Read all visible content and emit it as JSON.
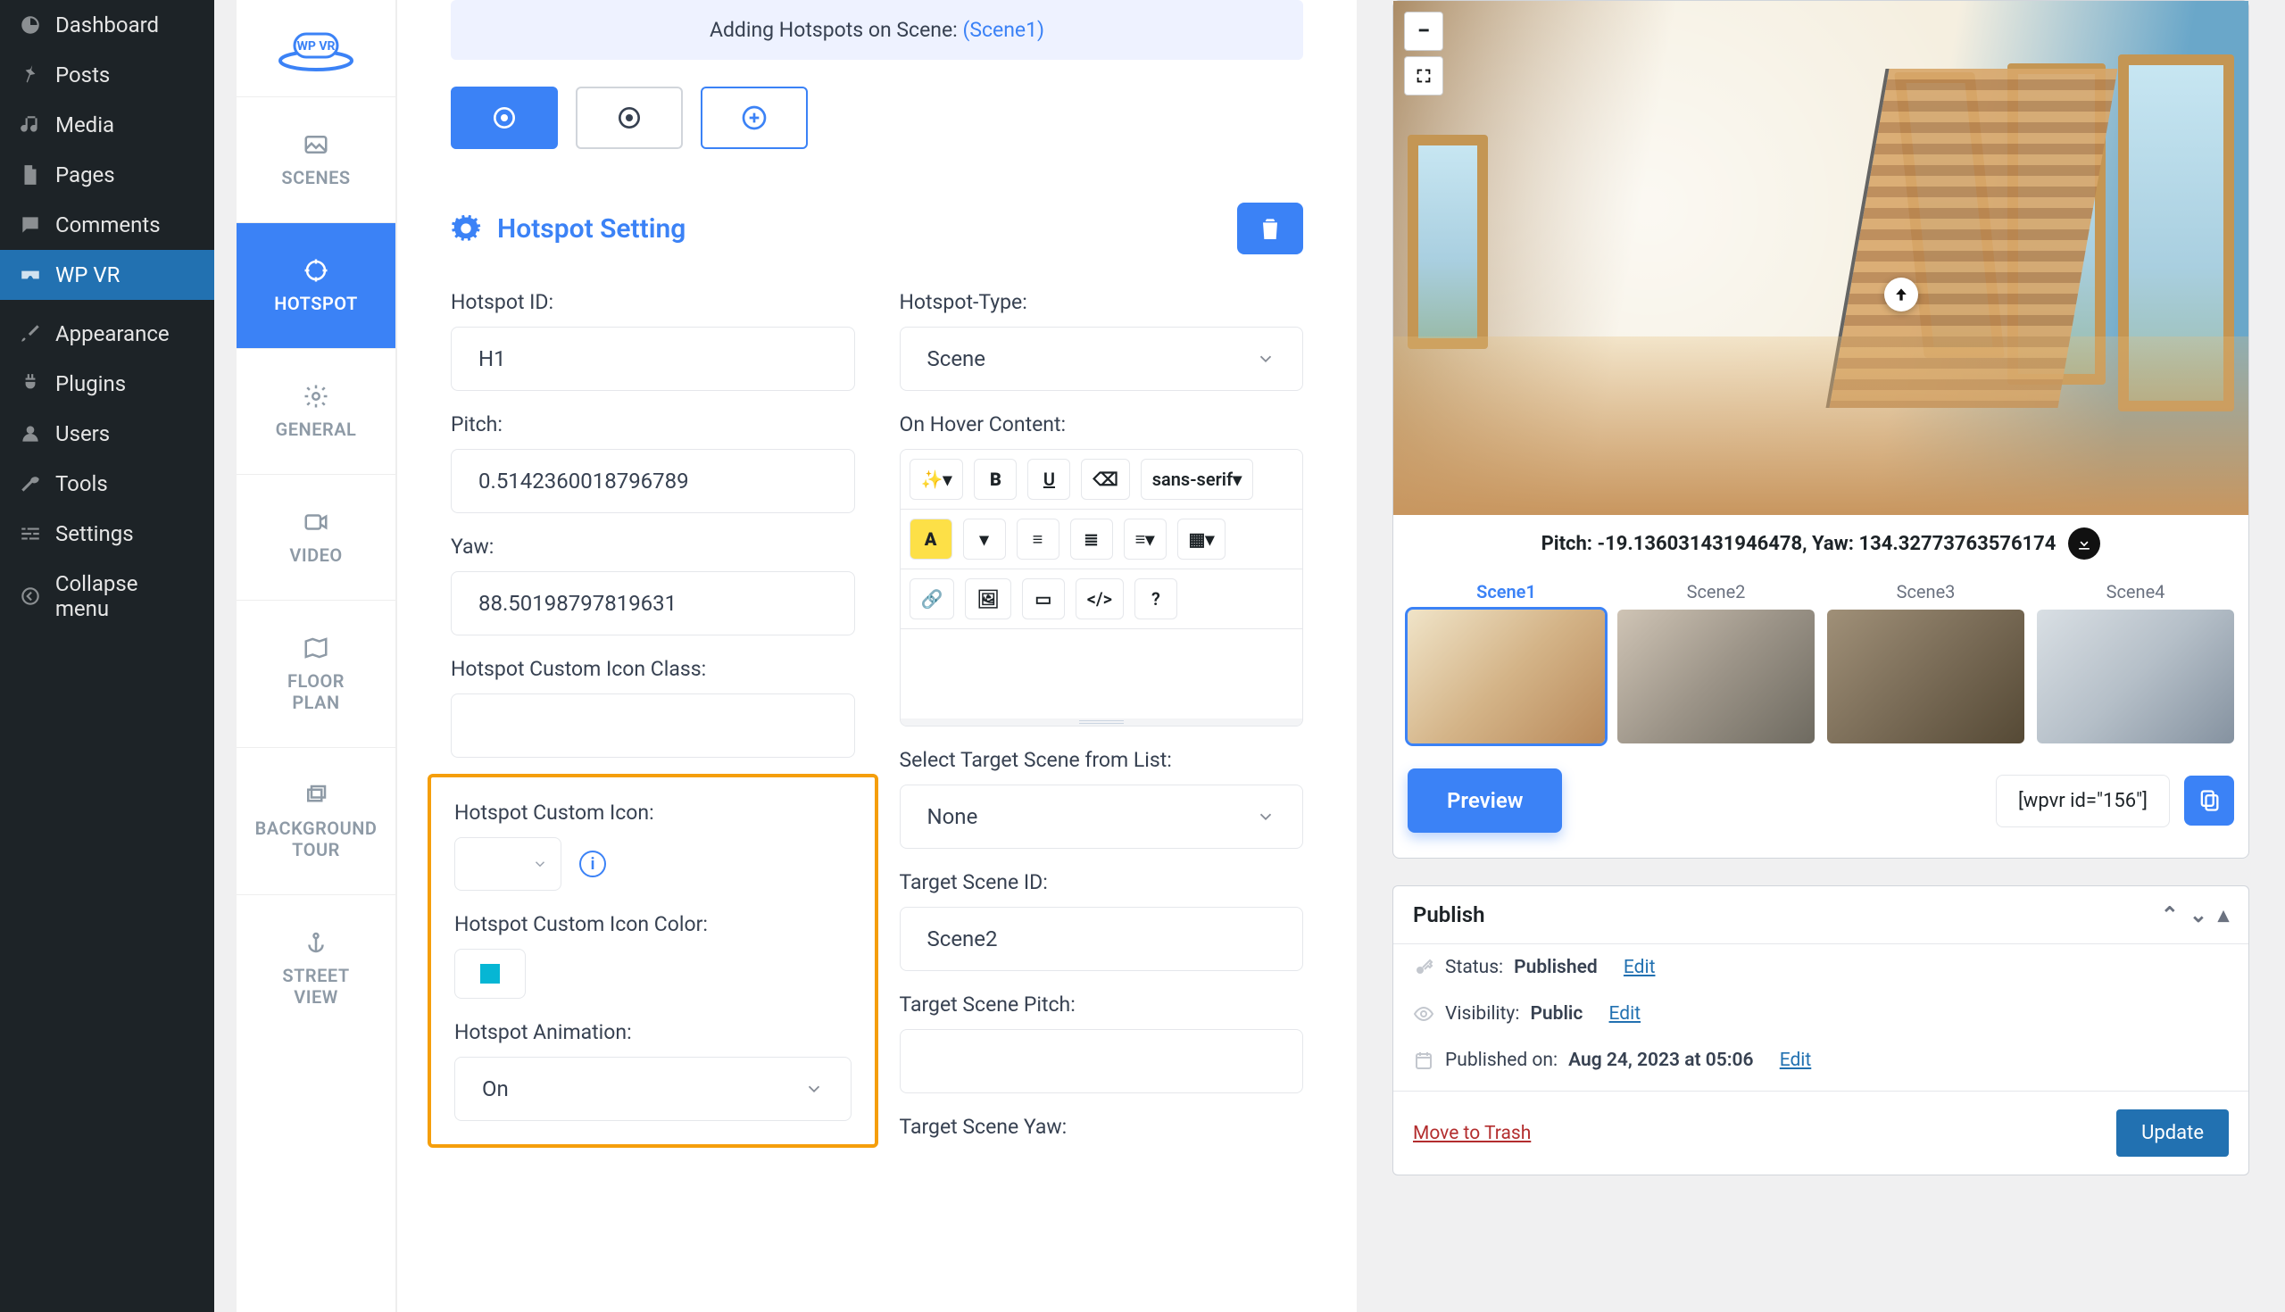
{
  "nav": {
    "dashboard": "Dashboard",
    "posts": "Posts",
    "media": "Media",
    "pages": "Pages",
    "comments": "Comments",
    "wpvr": "WP VR",
    "appearance": "Appearance",
    "plugins": "Plugins",
    "users": "Users",
    "tools": "Tools",
    "settings": "Settings",
    "collapse": "Collapse menu"
  },
  "plugin_logo": "WP VR",
  "tabs": {
    "scenes": "SCENES",
    "hotspot": "HOTSPOT",
    "general": "GENERAL",
    "video": "VIDEO",
    "floorplan_l1": "FLOOR",
    "floorplan_l2": "PLAN",
    "bgtour_l1": "BACKGROUND",
    "bgtour_l2": "TOUR",
    "street_l1": "STREET",
    "street_l2": "VIEW"
  },
  "notice": {
    "prefix": "Adding Hotspots on Scene: ",
    "scene": "(Scene1)"
  },
  "section_title": "Hotspot Setting",
  "form": {
    "hotspot_id_label": "Hotspot ID:",
    "hotspot_id_value": "H1",
    "pitch_label": "Pitch:",
    "pitch_value": "0.5142360018796789",
    "yaw_label": "Yaw:",
    "yaw_value": "88.50198797819631",
    "icon_class_label": "Hotspot Custom Icon Class:",
    "icon_class_value": "",
    "custom_icon_label": "Hotspot Custom Icon:",
    "icon_color_label": "Hotspot Custom Icon Color:",
    "animation_label": "Hotspot Animation:",
    "animation_value": "On",
    "type_label": "Hotspot-Type:",
    "type_value": "Scene",
    "hover_label": "On Hover Content:",
    "target_list_label": "Select Target Scene from List:",
    "target_list_value": "None",
    "target_id_label": "Target Scene ID:",
    "target_id_value": "Scene2",
    "target_pitch_label": "Target Scene Pitch:",
    "target_pitch_value": "",
    "target_yaw_label": "Target Scene Yaw:",
    "font_family": "sans-serif"
  },
  "preview": {
    "pitch_yaw": "Pitch: -19.136031431946478, Yaw: 134.32773763576174",
    "scenes": [
      "Scene1",
      "Scene2",
      "Scene3",
      "Scene4"
    ],
    "preview_btn": "Preview",
    "shortcode": "[wpvr id=\"156\"]"
  },
  "publish": {
    "title": "Publish",
    "status_label": "Status: ",
    "status_value": "Published",
    "visibility_label": "Visibility: ",
    "visibility_value": "Public",
    "published_label": "Published on: ",
    "published_value": "Aug 24, 2023 at 05:06",
    "edit": "Edit",
    "trash": "Move to Trash",
    "update": "Update"
  },
  "colors": {
    "accent": "#3b82f6",
    "highlight": "#f59e0b",
    "icon_color_swatch": "#06b6d4"
  },
  "thumb_colors": [
    "linear-gradient(135deg,#f0e4c8,#d4b488,#b8895a)",
    "linear-gradient(135deg,#cfc4b5,#9c9488,#6e6a60)",
    "linear-gradient(135deg,#a09078,#7a6c57,#554935)",
    "linear-gradient(135deg,#d9dfe4,#b5bfc8,#8592a0)"
  ]
}
